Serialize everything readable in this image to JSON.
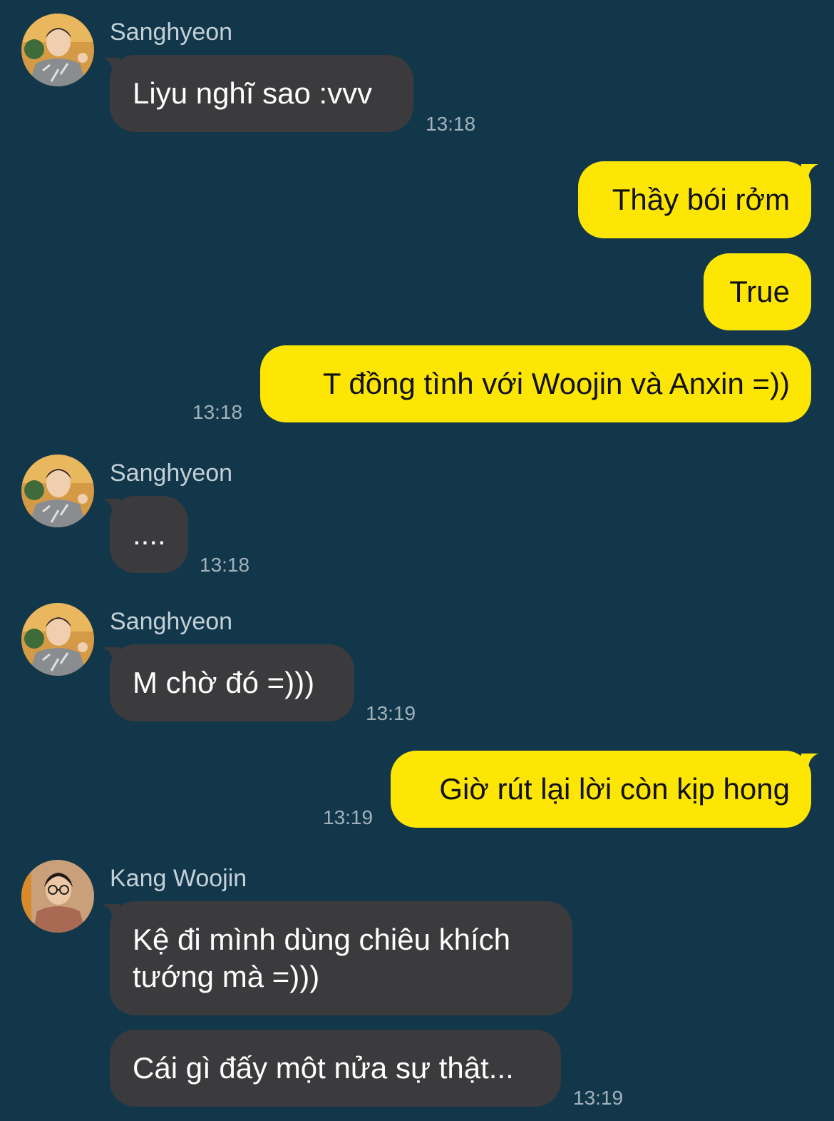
{
  "colors": {
    "background": "#13374a",
    "incoming_bubble": "#3b3b3d",
    "outgoing_bubble": "#fde603",
    "timestamp": "#a0b2bc",
    "sender_name": "#c3d0d8"
  },
  "messages": [
    {
      "sender": "Sanghyeon",
      "text": "Liyu nghĩ sao :vvv",
      "time": "13:18"
    },
    {
      "text": "Thầy bói rởm"
    },
    {
      "text": "True"
    },
    {
      "text": "T đồng tình với Woojin và Anxin =))",
      "time": "13:18"
    },
    {
      "sender": "Sanghyeon",
      "text": "....",
      "time": "13:18"
    },
    {
      "sender": "Sanghyeon",
      "text": "M chờ đó =)))",
      "time": "13:19"
    },
    {
      "text": "Giờ rút lại lời còn kịp hong",
      "time": "13:19"
    },
    {
      "sender": "Kang Woojin",
      "text": "Kệ đi mình dùng chiêu khích tướng mà =)))"
    },
    {
      "text": "Cái gì đấy một nửa sự thật...",
      "time": "13:19"
    }
  ]
}
